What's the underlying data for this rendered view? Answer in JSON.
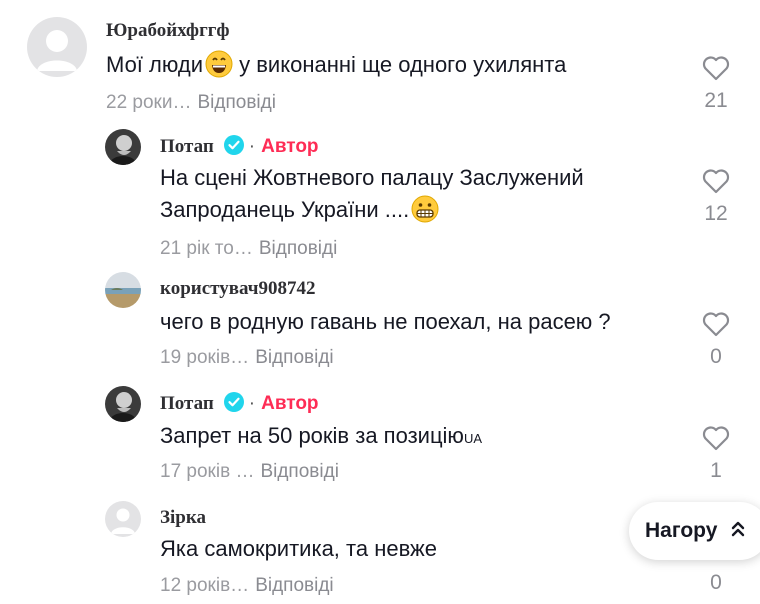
{
  "comments": [
    {
      "username": "Юрабойхфггф",
      "text": "Мої люди",
      "text_after": " у виконанні ще одного ухилянта",
      "emoji": "grinning-sweat-face",
      "time": "22 роки…",
      "reply": "Відповіді",
      "likes": "21"
    },
    {
      "username": "Потап",
      "badge": "Автор",
      "text_line1": "На сцені Жовтневого палацу Заслужений",
      "text_line2": "Запроданець України ....",
      "emoji": "grimacing-face",
      "time": "21 рік то…",
      "reply": "Відповіді",
      "likes": "12"
    },
    {
      "username": "користувач908742",
      "text": "чего в родную гавань не поехал, на расею ?",
      "time": "19 років…",
      "reply": "Відповіді",
      "likes": "0"
    },
    {
      "username": "Потап",
      "badge": "Автор",
      "text": "Запрет на 50 років за позицію",
      "text_small": "UA",
      "time": "17 років …",
      "reply": "Відповіді",
      "likes": "1"
    },
    {
      "username": "Зірка",
      "text": "Яка самокритика, та невже",
      "time": "12 років…",
      "reply": "Відповіді",
      "likes": "0"
    }
  ],
  "separator": "·",
  "back_to_top": {
    "label": "Нагору",
    "icon": "double-chevron-up-icon"
  },
  "colors": {
    "author_badge": "#fe2c55",
    "verified": "#20d5ec",
    "muted": "#8a8b91"
  }
}
